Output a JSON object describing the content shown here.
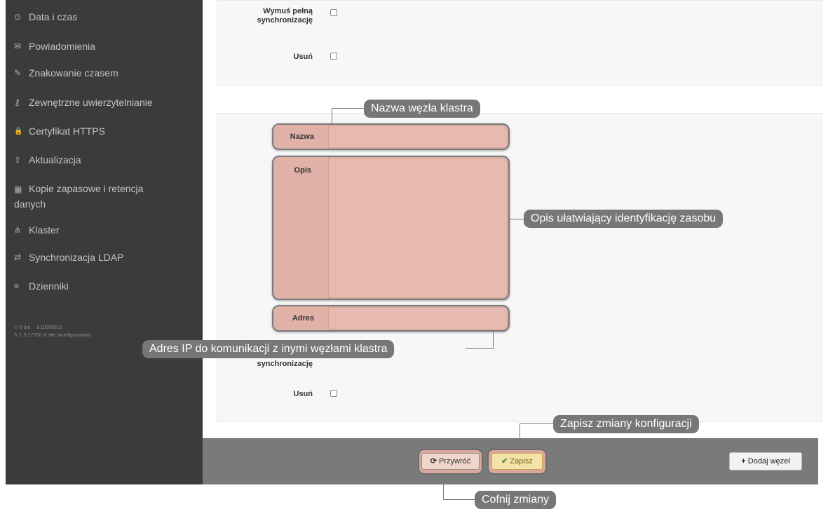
{
  "sidebar": {
    "items": [
      {
        "icon": "clock-icon",
        "glyph": "⊙",
        "label": "Data i czas"
      },
      {
        "icon": "envelope-icon",
        "glyph": "✉",
        "label": "Powiadomienia"
      },
      {
        "icon": "edit-icon",
        "glyph": "✎",
        "label": "Znakowanie czasem"
      },
      {
        "icon": "key-icon",
        "glyph": "⚷",
        "label": "Zewnętrzne uwierzytelnianie"
      },
      {
        "icon": "lock-icon",
        "glyph": "🔒",
        "label": "Certyfikat HTTPS"
      },
      {
        "icon": "upload-icon",
        "glyph": "⇪",
        "label": "Aktualizacja"
      },
      {
        "icon": "archive-icon",
        "glyph": "▦",
        "label": "Kopie zapasowe i retencja"
      },
      {
        "icon": "sitemap-icon",
        "glyph": "⋔",
        "label": "Klaster"
      },
      {
        "icon": "exchange-icon",
        "glyph": "⇄",
        "label": "Synchronizacja LDAP"
      },
      {
        "icon": "list-icon",
        "glyph": "≡",
        "label": "Dzienniki"
      }
    ],
    "item6_line2": "danych",
    "footer": {
      "uptime": "⊙ 6 dni",
      "build": "ℹ 10000010",
      "version": "✎ 1.3-17760",
      "cluster": "⋔ Nie skonfigurowany"
    }
  },
  "top_form": {
    "force_sync_label_l1": "Wymuś pełną",
    "force_sync_label_l2": "synchronizację",
    "delete_label": "Usuń"
  },
  "node_form": {
    "name_label": "Nazwa",
    "desc_label": "Opis",
    "address_label": "Adres",
    "force_sync_label_l2": "synchronizację",
    "delete_label": "Usuń"
  },
  "callouts": {
    "name": "Nazwa węzła klastra",
    "desc": "Opis ułatwiający identyfikację zasobu",
    "address": "Adres IP do komunikacji z inymi węzłami klastra",
    "save": "Zapisz zmiany konfiguracji",
    "revert": "Cofnij zmiany"
  },
  "buttons": {
    "revert": "Przywróć",
    "save": "Zapisz",
    "add_node": "Dodaj węzeł"
  }
}
